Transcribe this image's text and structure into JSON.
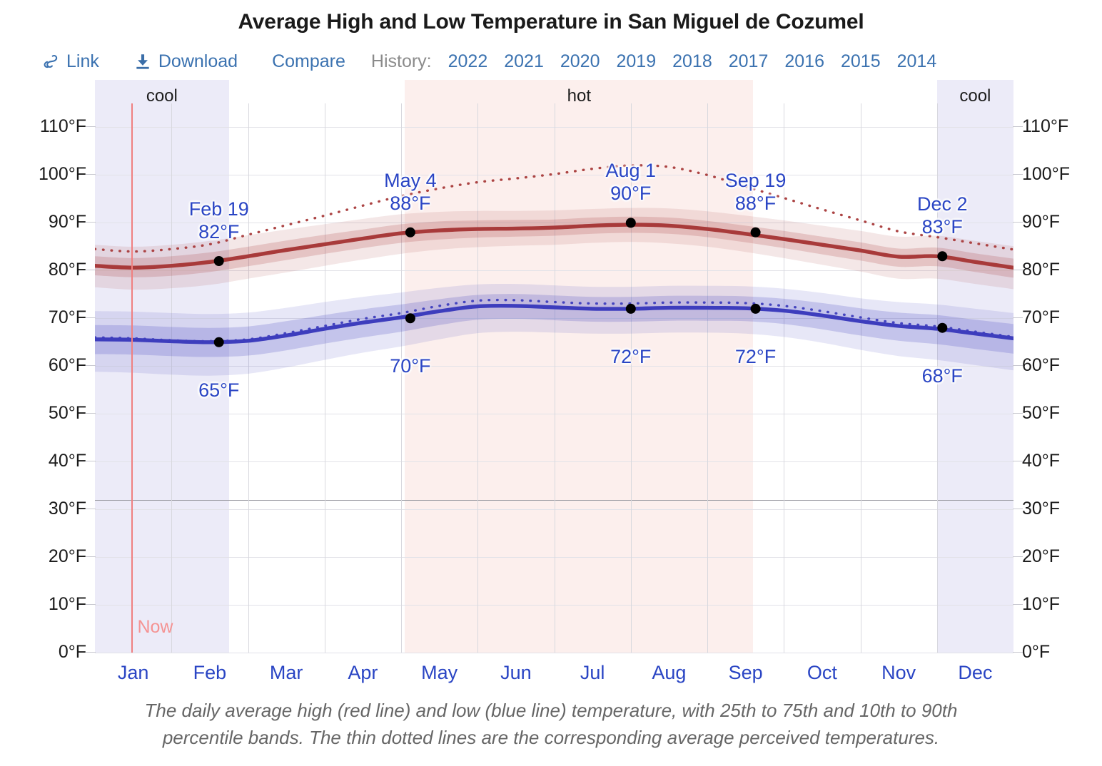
{
  "header": {
    "title": "Average High and Low Temperature in San Miguel de Cozumel"
  },
  "toolbar": {
    "link_label": "Link",
    "download_label": "Download",
    "compare_label": "Compare",
    "history_label": "History:",
    "years": [
      "2022",
      "2021",
      "2020",
      "2019",
      "2018",
      "2017",
      "2016",
      "2015",
      "2014"
    ]
  },
  "caption": {
    "line1": "The daily average high (red line) and low (blue line) temperature, with 25th to 75th and 10th to 90th",
    "line2": "percentile bands. The thin dotted lines are the corresponding average perceived temperatures."
  },
  "now_marker": {
    "label": "Now"
  },
  "colors": {
    "link_blue": "#3b72b0",
    "axis_blue": "#2a45c4",
    "high_line": "#a83a3a",
    "low_line": "#3d3dbd",
    "now_red": "#f08080",
    "cool_band": "#ecebf8",
    "hot_band": "#fcefed",
    "history_grey": "#8b8b8b"
  },
  "chart_data": {
    "type": "line",
    "title": "Average High and Low Temperature in San Miguel de Cozumel",
    "xlabel": "",
    "ylabel": "",
    "ylim": [
      0,
      115
    ],
    "grid": true,
    "legend": "none",
    "ytick_labels": [
      "0°F",
      "10°F",
      "20°F",
      "30°F",
      "40°F",
      "50°F",
      "60°F",
      "70°F",
      "80°F",
      "90°F",
      "100°F",
      "110°F"
    ],
    "ytick_values": [
      0,
      10,
      20,
      30,
      40,
      50,
      60,
      70,
      80,
      90,
      100,
      110
    ],
    "freezing_line": 32,
    "xtick_labels": [
      "Jan",
      "Feb",
      "Mar",
      "Apr",
      "May",
      "Jun",
      "Jul",
      "Aug",
      "Sep",
      "Oct",
      "Nov",
      "Dec"
    ],
    "seasons": [
      {
        "label": "cool",
        "start_month": 0.0,
        "end_month": 1.75,
        "color": "#ecebf8"
      },
      {
        "label": "hot",
        "start_month": 4.05,
        "end_month": 8.6,
        "color": "#fcefed"
      },
      {
        "label": "cool",
        "start_month": 11.0,
        "end_month": 12.0,
        "color": "#ecebf8"
      }
    ],
    "series": [
      {
        "name": "Average high temperature",
        "color": "#a83a3a",
        "style": "solid",
        "x_months": [
          0,
          0.5,
          1,
          1.5,
          2,
          2.5,
          3,
          3.5,
          4,
          4.5,
          5,
          5.5,
          6,
          6.5,
          7,
          7.5,
          8,
          8.5,
          9,
          9.5,
          10,
          10.5,
          11,
          11.5,
          12
        ],
        "values": [
          81,
          80.6,
          81,
          81.8,
          83,
          84.3,
          85.5,
          86.7,
          87.8,
          88.4,
          88.7,
          88.8,
          89,
          89.4,
          89.6,
          89.4,
          88.7,
          87.7,
          86.6,
          85.4,
          84.2,
          82.9,
          83,
          81.8,
          80.6
        ]
      },
      {
        "name": "Average low temperature",
        "color": "#3d3dbd",
        "style": "solid",
        "x_months": [
          0,
          0.5,
          1,
          1.5,
          2,
          2.5,
          3,
          3.5,
          4,
          4.5,
          5,
          5.5,
          6,
          6.5,
          7,
          7.5,
          8,
          8.5,
          9,
          9.5,
          10,
          10.5,
          11,
          11.5,
          12
        ],
        "values": [
          65.6,
          65.5,
          65.2,
          65,
          65.3,
          66.4,
          67.8,
          69.1,
          70.2,
          71.5,
          72.5,
          72.6,
          72.3,
          72,
          72,
          72.2,
          72.2,
          72.1,
          71.6,
          70.6,
          69.4,
          68.4,
          67.8,
          66.8,
          65.8
        ]
      },
      {
        "name": "Average perceived high temperature",
        "color": "#a83a3a",
        "style": "dotted",
        "x_months": [
          0,
          0.5,
          1,
          1.5,
          2,
          2.5,
          3,
          3.5,
          4,
          4.5,
          5,
          5.5,
          6,
          6.5,
          7,
          7.5,
          8,
          8.5,
          9,
          9.5,
          10,
          10.5,
          11,
          11.5,
          12
        ],
        "values": [
          84.5,
          84,
          84.5,
          85.5,
          87.5,
          89.5,
          91.5,
          93.6,
          95.6,
          97.2,
          98.5,
          99.3,
          100.2,
          101.3,
          102,
          101.7,
          100,
          97.6,
          95.2,
          92.8,
          90.5,
          88.2,
          87,
          85.7,
          84.4
        ]
      },
      {
        "name": "Average perceived low temperature",
        "color": "#3d3dbd",
        "style": "dotted",
        "x_months": [
          0,
          0.5,
          1,
          1.5,
          2,
          2.5,
          3,
          3.5,
          4,
          4.5,
          5,
          5.5,
          6,
          6.5,
          7,
          7.5,
          8,
          8.5,
          9,
          9.5,
          10,
          10.5,
          11,
          11.5,
          12
        ],
        "values": [
          66,
          65.8,
          65.4,
          65.2,
          65.6,
          66.9,
          68.4,
          69.9,
          71.1,
          72.6,
          73.7,
          73.8,
          73.4,
          73.1,
          73.1,
          73.3,
          73.3,
          73.2,
          72.6,
          71.5,
          70.2,
          69,
          68.3,
          67.2,
          66.1
        ]
      }
    ],
    "bands": [
      {
        "name": "High 10th-90th percentile",
        "color": "#a83a3a",
        "opacity": 0.12,
        "x_months": [
          0,
          0.5,
          1,
          1.5,
          2,
          2.5,
          3,
          3.5,
          4,
          4.5,
          5,
          5.5,
          6,
          6.5,
          7,
          7.5,
          8,
          8.5,
          9,
          9.5,
          10,
          10.5,
          11,
          11.5,
          12
        ],
        "lower": [
          76.5,
          76,
          76.3,
          77,
          78.3,
          79.6,
          81,
          82.3,
          83.5,
          84.4,
          84.9,
          85.2,
          85.4,
          85.8,
          86,
          85.7,
          85,
          83.9,
          82.6,
          81.2,
          79.8,
          78.3,
          78.3,
          77.2,
          76.1
        ],
        "upper": [
          85.4,
          85,
          85.4,
          86.2,
          87.4,
          88.6,
          89.7,
          90.8,
          91.8,
          92.3,
          92.5,
          92.5,
          92.6,
          92.9,
          93.1,
          93,
          92.4,
          91.5,
          90.5,
          89.4,
          88.3,
          87.1,
          87.3,
          86.2,
          85.1
        ]
      },
      {
        "name": "High 25th-75th percentile",
        "color": "#a83a3a",
        "opacity": 0.2,
        "x_months": [
          0,
          0.5,
          1,
          1.5,
          2,
          2.5,
          3,
          3.5,
          4,
          4.5,
          5,
          5.5,
          6,
          6.5,
          7,
          7.5,
          8,
          8.5,
          9,
          9.5,
          10,
          10.5,
          11,
          11.5,
          12
        ],
        "lower": [
          79,
          78.6,
          78.9,
          79.7,
          80.9,
          82.2,
          83.5,
          84.7,
          85.8,
          86.5,
          86.9,
          87.1,
          87.3,
          87.7,
          87.9,
          87.7,
          87,
          85.9,
          84.7,
          83.4,
          82.1,
          80.8,
          80.9,
          79.7,
          78.5
        ],
        "upper": [
          83,
          82.6,
          83,
          83.8,
          85,
          86.3,
          87.5,
          88.6,
          89.7,
          90.3,
          90.5,
          90.6,
          90.7,
          91.1,
          91.3,
          91.1,
          90.4,
          89.4,
          88.3,
          87.1,
          85.9,
          84.6,
          84.8,
          83.6,
          82.5
        ]
      },
      {
        "name": "Low 10th-90th percentile",
        "color": "#3d3dbd",
        "opacity": 0.12,
        "x_months": [
          0,
          0.5,
          1,
          1.5,
          2,
          2.5,
          3,
          3.5,
          4,
          4.5,
          5,
          5.5,
          6,
          6.5,
          7,
          7.5,
          8,
          8.5,
          9,
          9.5,
          10,
          10.5,
          11,
          11.5,
          12
        ],
        "lower": [
          58.8,
          58.6,
          58.2,
          58,
          58.4,
          59.7,
          61.3,
          62.8,
          64.1,
          65.6,
          66.9,
          67.2,
          67,
          66.8,
          66.8,
          67,
          67,
          66.8,
          66.1,
          64.9,
          63.4,
          62.1,
          61.3,
          60.2,
          59.1
        ],
        "upper": [
          71.5,
          71.4,
          71.1,
          70.9,
          71.2,
          72.2,
          73.4,
          74.5,
          75.4,
          76.4,
          77.1,
          77.2,
          76.9,
          76.6,
          76.6,
          76.8,
          76.8,
          76.7,
          76.2,
          75.3,
          74.2,
          73.4,
          72.9,
          72,
          71.1
        ]
      },
      {
        "name": "Low 25th-75th percentile",
        "color": "#3d3dbd",
        "opacity": 0.2,
        "x_months": [
          0,
          0.5,
          1,
          1.5,
          2,
          2.5,
          3,
          3.5,
          4,
          4.5,
          5,
          5.5,
          6,
          6.5,
          7,
          7.5,
          8,
          8.5,
          9,
          9.5,
          10,
          10.5,
          11,
          11.5,
          12
        ],
        "lower": [
          62.5,
          62.4,
          62.1,
          61.9,
          62.2,
          63.3,
          64.7,
          66,
          67.2,
          68.6,
          69.7,
          69.9,
          69.6,
          69.3,
          69.3,
          69.5,
          69.5,
          69.4,
          68.8,
          67.7,
          66.4,
          65.3,
          64.6,
          63.6,
          62.6
        ],
        "upper": [
          68.6,
          68.5,
          68.2,
          68,
          68.3,
          69.4,
          70.7,
          71.9,
          72.9,
          74,
          74.9,
          75.1,
          74.8,
          74.5,
          74.5,
          74.7,
          74.7,
          74.6,
          74.1,
          73.2,
          72.1,
          71.2,
          70.7,
          69.7,
          68.8
        ]
      }
    ],
    "annotations": [
      {
        "id": "feb19",
        "date": "Feb 19",
        "value": "82°F",
        "month_pos": 1.62,
        "temp": 82,
        "series": "high",
        "label_dy": -88
      },
      {
        "id": "feb19_low",
        "date": "",
        "value": "65°F",
        "month_pos": 1.62,
        "temp": 65,
        "series": "low",
        "label_dy": 52
      },
      {
        "id": "may4",
        "date": "May 4",
        "value": "88°F",
        "month_pos": 4.12,
        "temp": 88,
        "series": "high",
        "label_dy": -88
      },
      {
        "id": "may4_low",
        "date": "",
        "value": "70°F",
        "month_pos": 4.12,
        "temp": 70,
        "series": "low",
        "label_dy": 52
      },
      {
        "id": "aug1",
        "date": "Aug 1",
        "value": "90°F",
        "month_pos": 7.0,
        "temp": 90,
        "series": "high",
        "label_dy": -88
      },
      {
        "id": "aug1_low",
        "date": "",
        "value": "72°F",
        "month_pos": 7.0,
        "temp": 72,
        "series": "low",
        "label_dy": 52
      },
      {
        "id": "sep19",
        "date": "Sep 19",
        "value": "88°F",
        "month_pos": 8.63,
        "temp": 88,
        "series": "high",
        "label_dy": -88
      },
      {
        "id": "sep19_low",
        "date": "",
        "value": "72°F",
        "month_pos": 8.63,
        "temp": 72,
        "series": "low",
        "label_dy": 52
      },
      {
        "id": "dec2",
        "date": "Dec 2",
        "value": "83°F",
        "month_pos": 11.07,
        "temp": 83,
        "series": "high",
        "label_dy": -88
      },
      {
        "id": "dec2_low",
        "date": "",
        "value": "68°F",
        "month_pos": 11.07,
        "temp": 68,
        "series": "low",
        "label_dy": 52
      }
    ],
    "now_month": 0.48
  }
}
